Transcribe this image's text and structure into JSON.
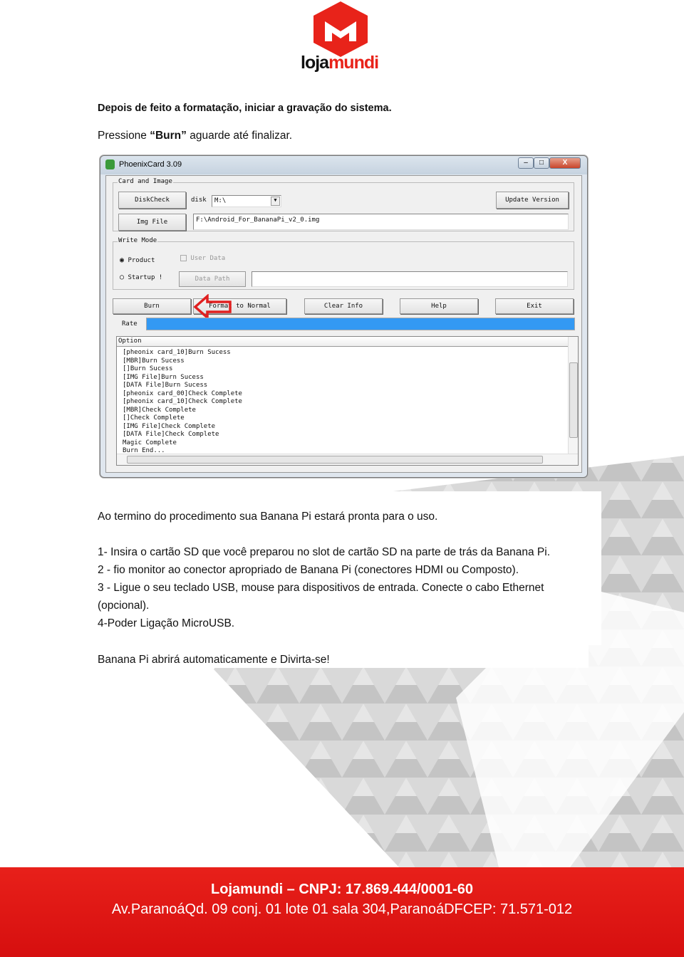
{
  "logo": {
    "text": "lojamundi",
    "brand_color": "#e8231a"
  },
  "intro": {
    "line1": "Depois de feito a formatação, iniciar a gravação do sistema.",
    "line2_prefix": "Pressione ",
    "line2_bold": "“Burn”",
    "line2_suffix": " aguarde até finalizar."
  },
  "window": {
    "title": "PhoenixCard 3.09",
    "close_glyph": "X",
    "card_group": "Card and Image",
    "diskcheck": "DiskCheck",
    "disk_label": "disk",
    "disk_value": "M:\\",
    "update_version": "Update Version",
    "img_file": "Img File",
    "img_path": "F:\\Android_For_BananaPi_v2_0.img",
    "write_mode": "Write Mode",
    "product": "Product",
    "startup": "Startup !",
    "user_data": "User Data",
    "data_path": "Data Path",
    "buttons": {
      "burn": "Burn",
      "format": "Format to Normal",
      "clear": "Clear Info",
      "help": "Help",
      "exit": "Exit"
    },
    "rate_label": "Rate",
    "rate_percent": 100,
    "log_header": "Option",
    "log": [
      "[pheonix card_10]Burn Sucess",
      "[MBR]Burn Sucess",
      "[]Burn Sucess",
      "[IMG File]Burn Sucess",
      "[DATA File]Burn Sucess",
      "[pheonix card_00]Check Complete",
      "[pheonix card_10]Check Complete",
      "[MBR]Check Complete",
      "[]Check Complete",
      "[IMG File]Check Complete",
      "[DATA File]Check Complete",
      "Magic Complete",
      "Burn End..."
    ]
  },
  "body": {
    "done": "Ao termino do procedimento sua Banana Pi estará pronta para o uso.",
    "steps": [
      "1- Insira o cartão SD que você preparou no slot de cartão SD na parte de trás da Banana Pi.",
      "2 - fio monitor ao conector apropriado de Banana Pi (conectores HDMI ou Composto).",
      "3 - Ligue o seu teclado USB, mouse para dispositivos de entrada. Conecte o cabo Ethernet",
      "(opcional).",
      "4-Poder Ligação MicroUSB."
    ],
    "closing": "Banana Pi abrirá automaticamente e Divirta-se!"
  },
  "footer": {
    "line1": "Lojamundi – CNPJ: 17.869.444/0001-60",
    "line2": "Av.ParanoáQd. 09 conj. 01 lote 01 sala 304,ParanoáDFCEP: 71.571-012"
  }
}
